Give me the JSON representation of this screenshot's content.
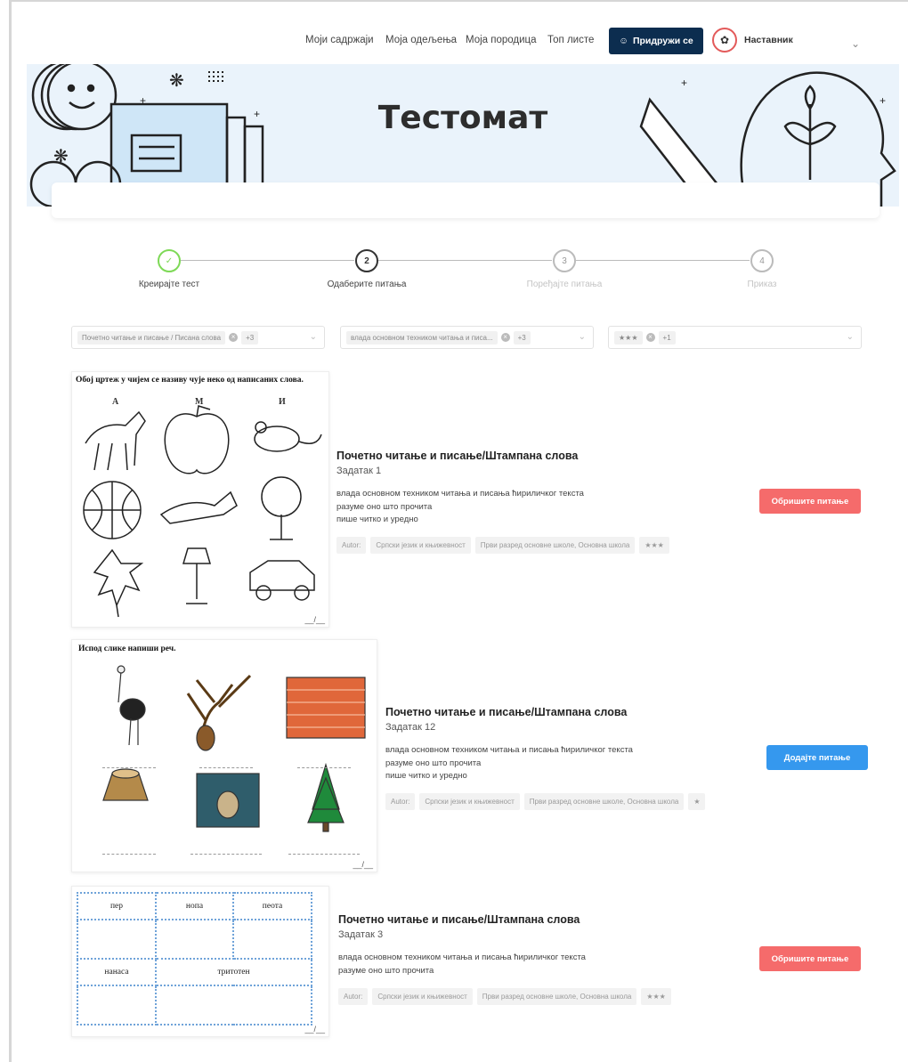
{
  "nav": {
    "links": [
      "Моји садржаји",
      "Моја одељења",
      "Моја породица",
      "Топ листе"
    ],
    "join_label": "Придружи се",
    "user_label": "Наставник"
  },
  "banner": {
    "title": "Тестомат"
  },
  "steps": [
    {
      "num": "✓",
      "label": "Креирајте тест",
      "state": "done"
    },
    {
      "num": "2",
      "label": "Одаберите питања",
      "state": "active"
    },
    {
      "num": "3",
      "label": "Поређајте питања",
      "state": "inactive"
    },
    {
      "num": "4",
      "label": "Приказ",
      "state": "inactive"
    }
  ],
  "filters": [
    {
      "chip": "Почетно читање и писање / Писана слова",
      "more": "+3"
    },
    {
      "chip": "влада основном техником читања и писа...",
      "more": "+3"
    },
    {
      "chip": "★★★",
      "more": "+1"
    }
  ],
  "questions": [
    {
      "image_heading": "Обој цртеж у чијем се називу чује неко од написаних слова.",
      "letters": [
        "А",
        "М",
        "И"
      ],
      "page_mark": "__/__",
      "title": "Почетно читање и писање/Штампана слова",
      "subtitle": "Задатак 1",
      "lines": [
        "влада основном техником читања и писања ћириличког текста",
        "разуме оно што прочита",
        "пише читко и уредно"
      ],
      "tags": [
        "Autor:",
        "Српски језик и књижевност",
        "Први разред основне школе, Основна школа",
        "★★★"
      ],
      "button": "Обришите питање",
      "button_color": "#f56b6b"
    },
    {
      "image_heading": "Испод слике напиши реч.",
      "page_mark": "__/__",
      "title": "Почетно читање и писање/Штампана слова",
      "subtitle": "Задатак 12",
      "lines": [
        "влада основном техником читања и писања ћириличког текста",
        "разуме оно што прочита",
        "пише читко и уредно"
      ],
      "tags": [
        "Autor:",
        "Српски језик и књижевност",
        "Први разред основне школе, Основна школа",
        "★"
      ],
      "button": "Додајте питање",
      "button_color": "#3598ee"
    },
    {
      "words": [
        "пер",
        "нопа",
        "пеота",
        "нанаса",
        "тритотен"
      ],
      "page_mark": "__/__",
      "title": "Почетно читање и писање/Штампана слова",
      "subtitle": "Задатак 3",
      "lines": [
        "влада основном техником читања и писања ћириличког текста",
        "разуме оно што прочита"
      ],
      "tags": [
        "Autor:",
        "Српски језик и књижевност",
        "Први разред основне школе, Основна школа",
        "★★★"
      ],
      "button": "Обришите питање",
      "button_color": "#f56b6b"
    }
  ]
}
